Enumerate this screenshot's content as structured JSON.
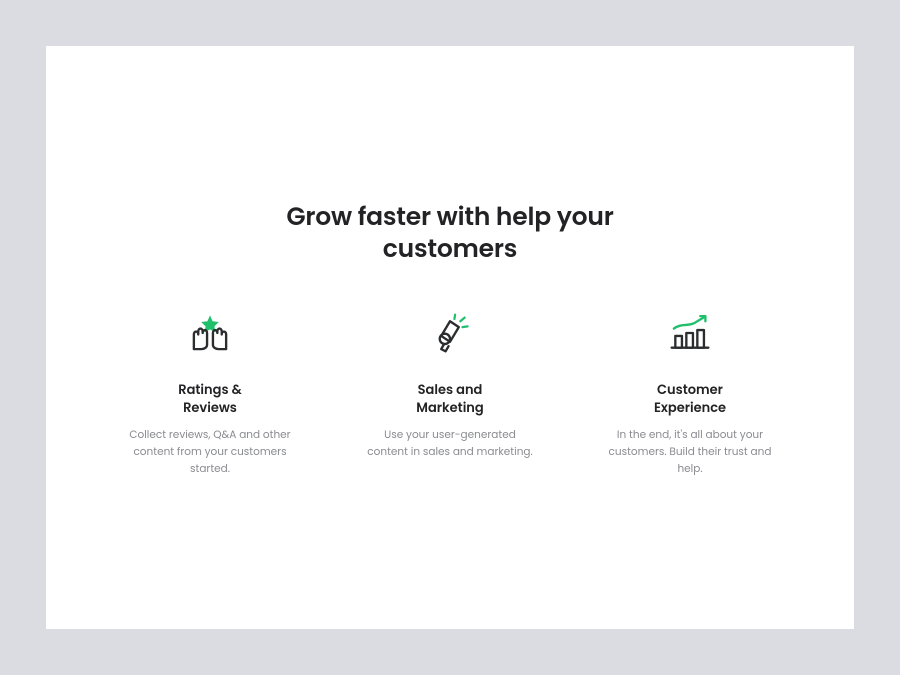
{
  "heading": "Grow faster with help your customers",
  "features": [
    {
      "icon": "hands-star-icon",
      "title": "Ratings &\nReviews",
      "desc": "Collect reviews, Q&A and other content from your customers started."
    },
    {
      "icon": "megaphone-icon",
      "title": "Sales and\nMarketing",
      "desc": "Use your user-generated content in sales and marketing."
    },
    {
      "icon": "chart-growth-icon",
      "title": "Customer\nExperience",
      "desc": "In the end, it's all about your customers. Build their trust and help."
    }
  ]
}
